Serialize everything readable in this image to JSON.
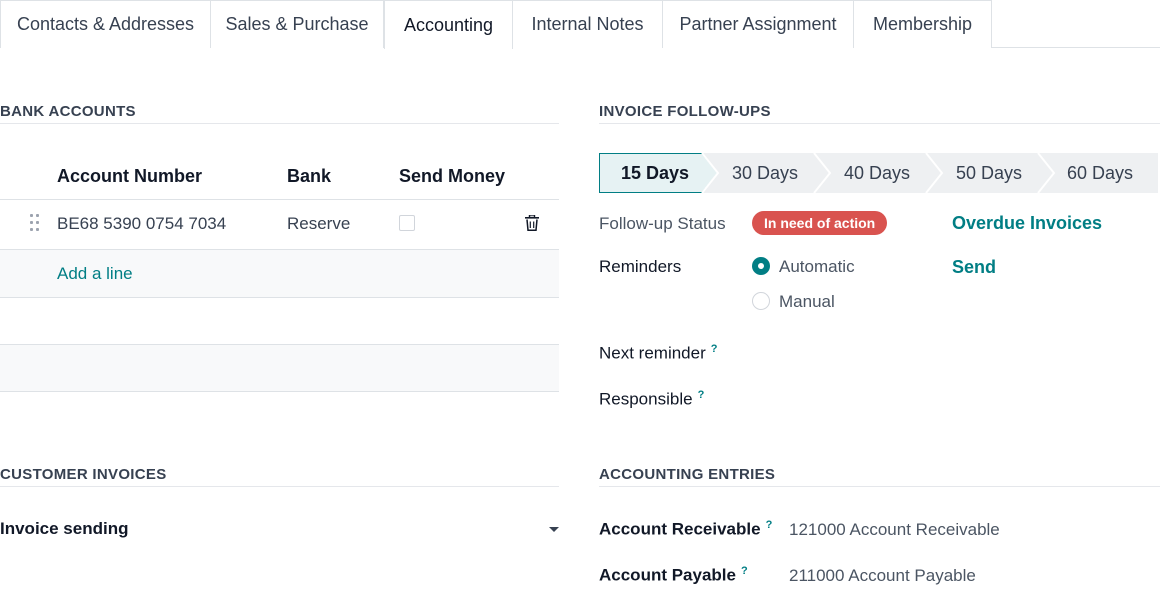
{
  "tabs": [
    {
      "label": "Contacts & Addresses",
      "active": false
    },
    {
      "label": "Sales & Purchase",
      "active": false
    },
    {
      "label": "Accounting",
      "active": true
    },
    {
      "label": "Internal Notes",
      "active": false
    },
    {
      "label": "Partner Assignment",
      "active": false
    },
    {
      "label": "Membership",
      "active": false
    }
  ],
  "bank_accounts": {
    "title": "BANK ACCOUNTS",
    "columns": [
      "Account Number",
      "Bank",
      "Send Money"
    ],
    "rows": [
      {
        "account_number": "BE68 5390 0754 7034",
        "bank": "Reserve",
        "send_money": false
      }
    ],
    "add_line": "Add a line"
  },
  "followups": {
    "title": "INVOICE FOLLOW-UPS",
    "steps": [
      "15 Days",
      "30 Days",
      "40 Days",
      "50 Days",
      "60 Days"
    ],
    "active_step": "15 Days",
    "status_label": "Follow-up Status",
    "status_badge": "In need of action",
    "overdue_link": "Overdue Invoices",
    "reminders_label": "Reminders",
    "reminder_options": [
      "Automatic",
      "Manual"
    ],
    "reminder_selected": "Automatic",
    "send_link": "Send",
    "next_reminder_label": "Next reminder",
    "responsible_label": "Responsible",
    "help_mark": "?"
  },
  "customer_invoices": {
    "title": "CUSTOMER INVOICES",
    "invoice_sending_label": "Invoice sending"
  },
  "accounting_entries": {
    "title": "ACCOUNTING ENTRIES",
    "receivable_label": "Account Receivable",
    "receivable_value": "121000 Account Receivable",
    "payable_label": "Account Payable",
    "payable_value": "211000 Account Payable"
  },
  "colors": {
    "accent": "#017e84",
    "badge_danger": "#d9534f",
    "active_step_bg": "#e6f2f3"
  },
  "icons": {
    "drag": "drag-handle-icon",
    "delete": "trash-icon",
    "dropdown": "caret-down-icon"
  }
}
